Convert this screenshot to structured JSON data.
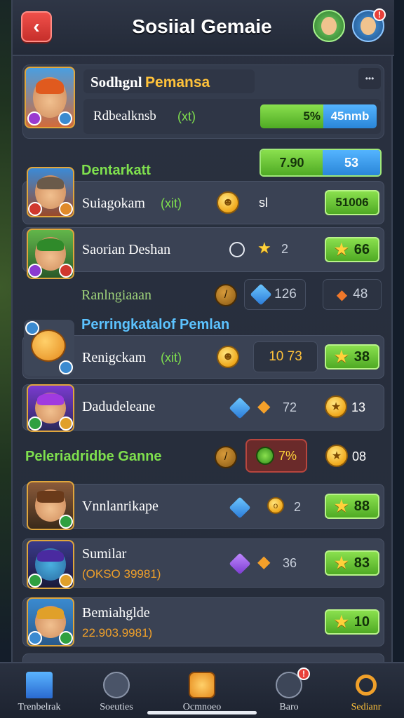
{
  "header": {
    "title": "Sosiial Gemaie",
    "back_icon": "‹",
    "notif_count": "!"
  },
  "profile": {
    "name_part1": "Sodhgnl",
    "name_part2": "Pemansa",
    "subtitle": "Rdbealknsb",
    "subtitle_tag": "(xt)",
    "bar_left": "5%",
    "bar_right": "45nmb",
    "more_icon": "•••"
  },
  "section1": {
    "label": "Dentarkatt",
    "bar_left": "7.90",
    "bar_right": "53"
  },
  "row1": {
    "name": "Suiagokam",
    "tag": "(xit)",
    "stat": "sl",
    "pill": "51006"
  },
  "row2": {
    "name": "Saorian Deshan",
    "stat": "2",
    "pill": "66"
  },
  "section2": {
    "label": "Ranlngiaaan",
    "gem_stat": "126",
    "fire_stat": "48"
  },
  "section3": {
    "label": "Perringkatalof Pemlan"
  },
  "row3": {
    "name": "Renigckam",
    "tag": "(xit)",
    "box": "10 73",
    "pill": "38"
  },
  "row4": {
    "name": "Dadudeleane",
    "stat": "72",
    "coin_stat": "13"
  },
  "section4": {
    "label": "Peleriadridbe Ganne",
    "red_box": "7%",
    "coin_stat": "08"
  },
  "row5": {
    "name": "Vnnlanrikape",
    "stat": "2",
    "pill": "88"
  },
  "row6": {
    "name": "Sumilar",
    "sub": "(OKSO 39981)",
    "stat": "36",
    "pill": "83"
  },
  "row7": {
    "name": "Bemiahglde",
    "sub": "22.903.9981)",
    "pill": "10"
  },
  "tabs": [
    {
      "label": "Trenbelrak"
    },
    {
      "label": "Soeuties"
    },
    {
      "label": "Ocmnoeo"
    },
    {
      "label": "Baro"
    },
    {
      "label": "Sedianr"
    }
  ],
  "colors": {
    "accent_green": "#7fe04e",
    "accent_blue": "#3aa0f0",
    "brand_red": "#e8403a",
    "gold": "#f0a91c"
  }
}
